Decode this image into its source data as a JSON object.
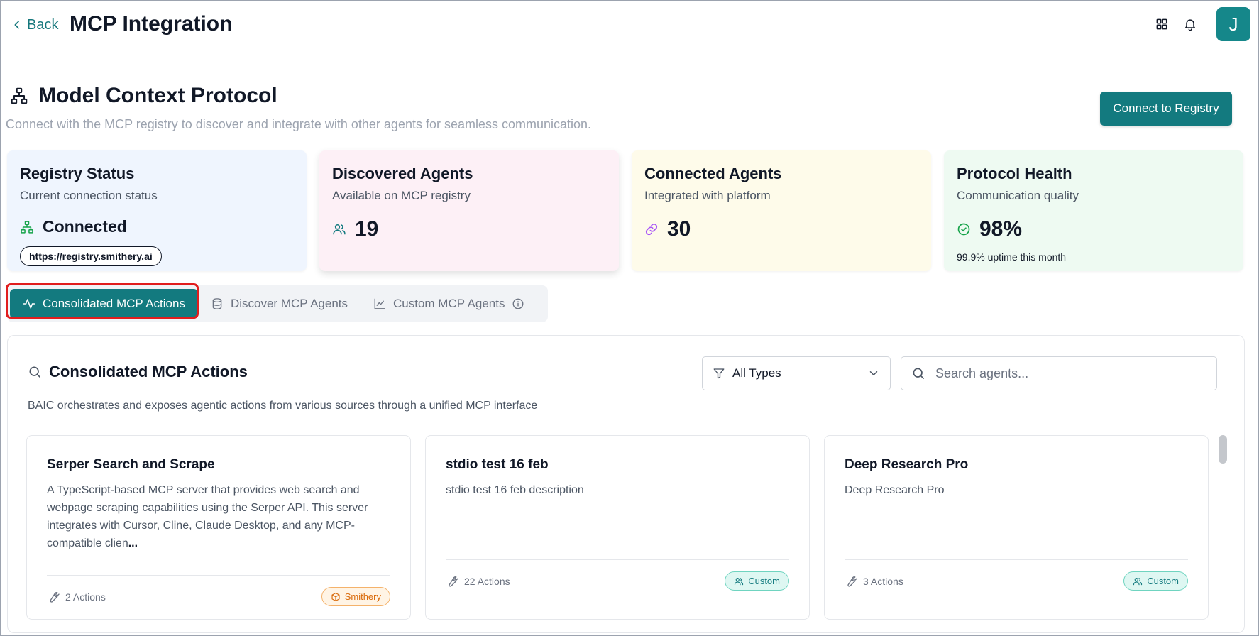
{
  "header": {
    "back_label": "Back",
    "title": "MCP Integration",
    "avatar_initial": "J"
  },
  "section": {
    "title": "Model Context Protocol",
    "subtitle": "Connect with the MCP registry to discover and integrate with other agents for seamless communication.",
    "connect_button": "Connect to Registry"
  },
  "stats": {
    "registry": {
      "title": "Registry Status",
      "subtitle": "Current connection status",
      "status": "Connected",
      "url": "https://registry.smithery.ai"
    },
    "discovered": {
      "title": "Discovered Agents",
      "subtitle": "Available on MCP registry",
      "value": "19"
    },
    "connected": {
      "title": "Connected Agents",
      "subtitle": "Integrated with platform",
      "value": "30"
    },
    "health": {
      "title": "Protocol Health",
      "subtitle": "Communication quality",
      "value": "98%",
      "note": "99.9% uptime this month"
    }
  },
  "tabs": [
    {
      "label": "Consolidated MCP Actions",
      "active": true
    },
    {
      "label": "Discover MCP Agents",
      "active": false
    },
    {
      "label": "Custom MCP Agents",
      "active": false
    }
  ],
  "panel": {
    "title": "Consolidated MCP Actions",
    "subtitle": "BAIC orchestrates and exposes agentic actions from various sources through a unified MCP interface",
    "filter_value": "All Types",
    "search_placeholder": "Search agents..."
  },
  "cards": [
    {
      "title": "Serper Search and Scrape",
      "description": "A TypeScript-based MCP server that provides web search and webpage scraping capabilities using the Serper API. This server integrates with Cursor, Cline, Claude Desktop, and any MCP-compatible clien",
      "more": "...",
      "actions": "2 Actions",
      "badge": "Smithery"
    },
    {
      "title": "stdio test 16 feb",
      "description": "stdio test 16 feb description",
      "actions": "22 Actions",
      "badge": "Custom"
    },
    {
      "title": "Deep Research Pro",
      "description": "Deep Research Pro",
      "actions": "3 Actions",
      "badge": "Custom"
    }
  ],
  "colors": {
    "accent": "#137a7f",
    "highlight": "#e11d1d",
    "smithery": "#d96a0b"
  }
}
